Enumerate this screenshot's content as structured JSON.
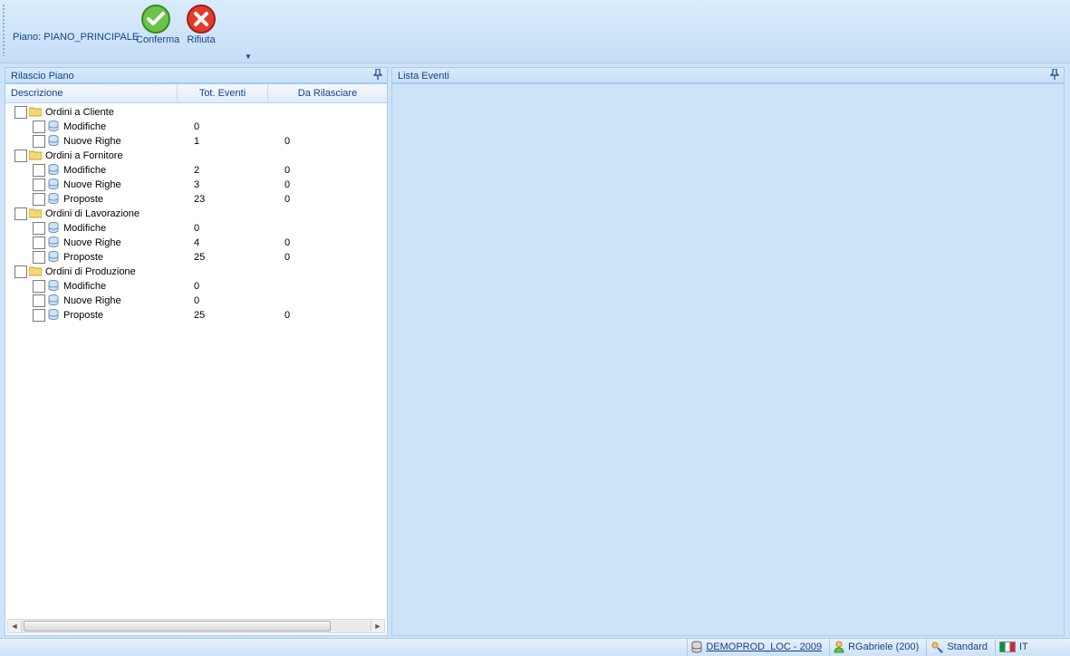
{
  "toolbar": {
    "plan_label": "Piano: PIANO_PRINCIPALE",
    "confirm_label": "Conferma",
    "reject_label": "Rifiuta"
  },
  "panels": {
    "left_title": "Rilascio Piano",
    "right_title": "Lista Eventi"
  },
  "columns": {
    "desc": "Descrizione",
    "tot": "Tot. Eventi",
    "rel": "Da Rilasciare"
  },
  "tree": [
    {
      "label": "Ordini a Cliente",
      "children": [
        {
          "label": "Modifiche",
          "tot": "0",
          "rel": ""
        },
        {
          "label": "Nuove Righe",
          "tot": "1",
          "rel": "0"
        }
      ]
    },
    {
      "label": "Ordini a Fornitore",
      "children": [
        {
          "label": "Modifiche",
          "tot": "2",
          "rel": "0"
        },
        {
          "label": "Nuove Righe",
          "tot": "3",
          "rel": "0"
        },
        {
          "label": "Proposte",
          "tot": "23",
          "rel": "0"
        }
      ]
    },
    {
      "label": "Ordini di Lavorazione",
      "children": [
        {
          "label": "Modifiche",
          "tot": "0",
          "rel": ""
        },
        {
          "label": "Nuove Righe",
          "tot": "4",
          "rel": "0"
        },
        {
          "label": "Proposte",
          "tot": "25",
          "rel": "0"
        }
      ]
    },
    {
      "label": "Ordini di Produzione",
      "children": [
        {
          "label": "Modifiche",
          "tot": "0",
          "rel": ""
        },
        {
          "label": "Nuove Righe",
          "tot": "0",
          "rel": ""
        },
        {
          "label": "Proposte",
          "tot": "25",
          "rel": "0"
        }
      ]
    }
  ],
  "status": {
    "db": "DEMOPROD_LOC - 2009",
    "user": "RGabriele (200)",
    "profile": "Standard",
    "lang": "IT"
  }
}
